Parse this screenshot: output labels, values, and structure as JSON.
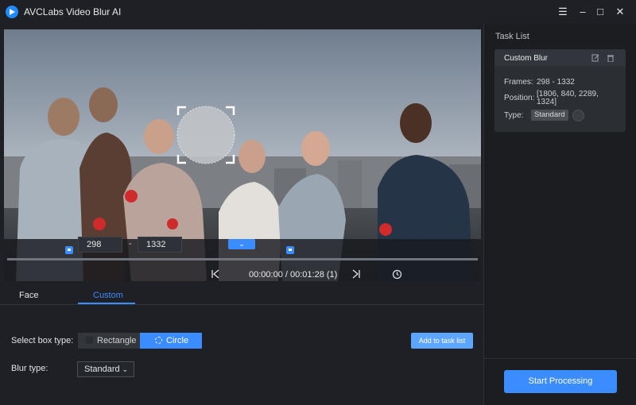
{
  "window": {
    "title": "AVCLabs Video Blur AI",
    "menu_icon": "menu-icon",
    "minimize_icon": "minimize-icon",
    "maximize_icon": "maximize-icon",
    "close_icon": "close-icon"
  },
  "player": {
    "start_frame": "298",
    "end_frame": "1332",
    "separator": "-",
    "timecode": "00:00:00 / 00:01:28 (1)"
  },
  "tabs": [
    {
      "label": "Face",
      "active": false
    },
    {
      "label": "Custom",
      "active": true
    }
  ],
  "settings": {
    "box_type_label": "Select box type:",
    "rectangle_label": "Rectangle",
    "circle_label": "Circle",
    "add_task_label": "Add to task list",
    "blur_type_label": "Blur type:",
    "blur_type_value": "Standard"
  },
  "task_list": {
    "title": "Task List",
    "task": {
      "name": "Custom Blur",
      "frames_label": "Frames:",
      "frames_value": "298 - 1332",
      "position_label": "Position:",
      "position_line1": "[1806, 840, 2289,",
      "position_line2": "1324]",
      "type_label": "Type:",
      "type_value": "Standard"
    }
  },
  "start_button_label": "Start Processing",
  "colors": {
    "accent": "#3b8cff",
    "background": "#1e2025",
    "panel": "#2b2e33"
  }
}
